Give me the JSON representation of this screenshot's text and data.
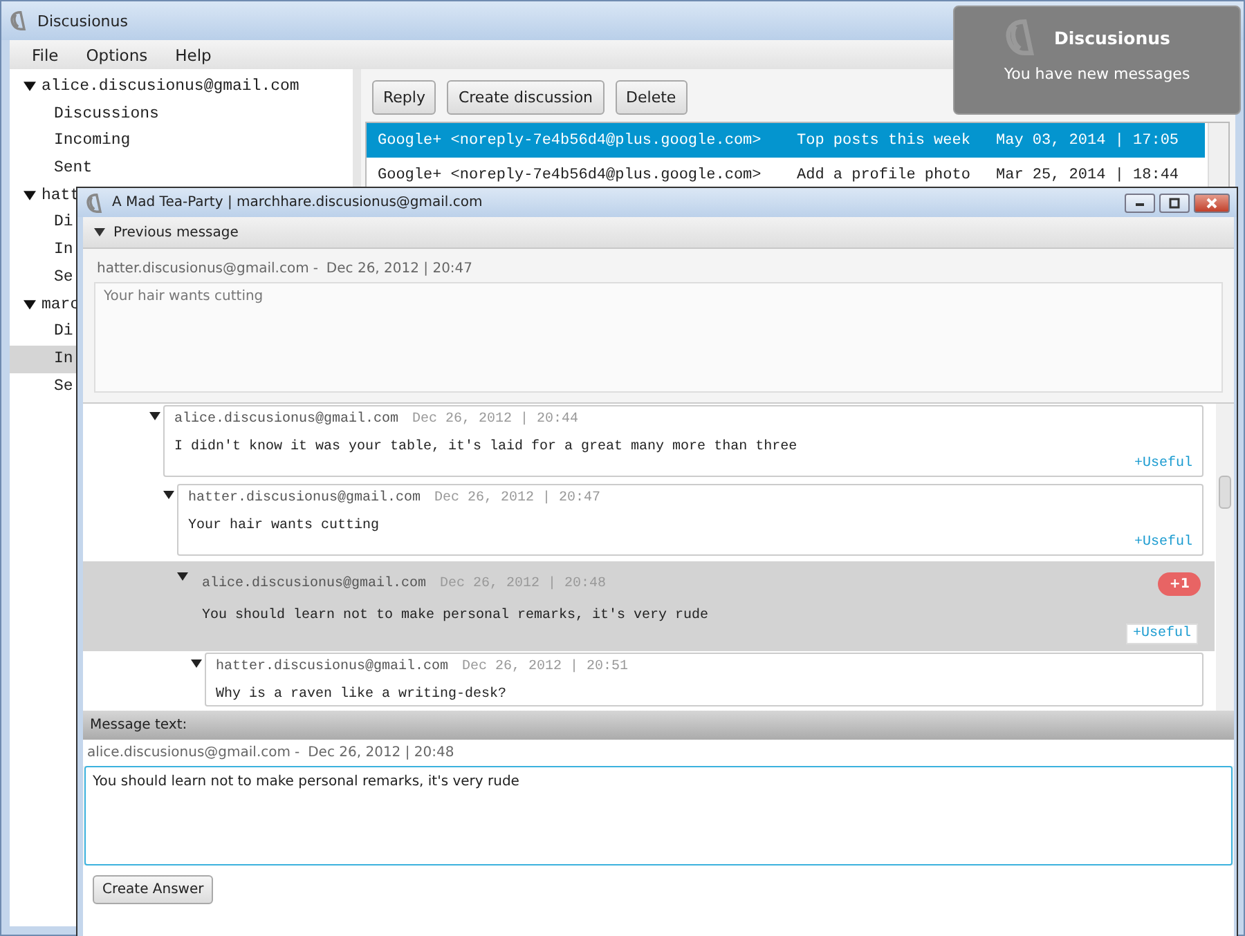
{
  "window": {
    "title": "Discusionus"
  },
  "menu": [
    "File",
    "Options",
    "Help"
  ],
  "accounts": [
    {
      "label": "alice.discusionus@gmail.com",
      "expanded": true,
      "children": [
        {
          "label": "Discussions",
          "selected": false
        },
        {
          "label": "Incoming",
          "selected": false
        },
        {
          "label": "Sent",
          "selected": false
        }
      ]
    },
    {
      "label": "hatt",
      "expanded": true,
      "children": [
        {
          "label": "Di",
          "selected": false
        },
        {
          "label": "In",
          "selected": false
        },
        {
          "label": "Se",
          "selected": false
        }
      ]
    },
    {
      "label": "marc",
      "expanded": true,
      "children": [
        {
          "label": "Di",
          "selected": false
        },
        {
          "label": "In",
          "selected": true
        },
        {
          "label": "Se",
          "selected": false
        }
      ]
    }
  ],
  "toolbar": [
    "Reply",
    "Create discussion",
    "Delete"
  ],
  "messages": [
    {
      "sender": "Google+ <noreply-7e4b56d4@plus.google.com>",
      "subject": "Top posts this week",
      "date": "May 03, 2014 | 17:05",
      "selected": true
    },
    {
      "sender": "Google+ <noreply-7e4b56d4@plus.google.com>",
      "subject": "Add a profile photo",
      "date": "Mar 25, 2014 | 18:44",
      "selected": false
    }
  ],
  "notification": {
    "title": "Discusionus",
    "text": "You have new messages"
  },
  "dialog": {
    "title": "A Mad Tea-Party | marchhare.discusionus@gmail.com",
    "previous": {
      "label": "Previous message",
      "expanded": true,
      "author": "hatter.discusionus@gmail.com",
      "separator": "-",
      "date": "Dec 26, 2012 | 20:47",
      "text": "Your hair wants cutting"
    },
    "thread": [
      {
        "author": "alice.discusionus@gmail.com",
        "date": "Dec 26, 2012 | 20:44",
        "text": "I didn't know it was your table, it's laid for a great many more than three",
        "useful": "+Useful",
        "selected": false,
        "expanded": true,
        "children": [
          {
            "author": "hatter.discusionus@gmail.com",
            "date": "Dec 26, 2012 | 20:47",
            "text": "Your hair wants cutting",
            "useful": "+Useful",
            "selected": false,
            "expanded": true,
            "children": [
              {
                "author": "alice.discusionus@gmail.com",
                "date": "Dec 26, 2012 | 20:48",
                "text": "You should learn not to make personal remarks, it's very rude",
                "useful": "+Useful",
                "votes": "+1",
                "selected": true,
                "expanded": true,
                "children": [
                  {
                    "author": "hatter.discusionus@gmail.com",
                    "date": "Dec 26, 2012 | 20:51",
                    "text": "Why is a raven like a writing-desk?",
                    "selected": false,
                    "expanded": true
                  }
                ]
              }
            ]
          }
        ]
      }
    ],
    "message_label": "Message text:",
    "reply_to": {
      "author": "alice.discusionus@gmail.com",
      "separator": "-",
      "date": "Dec 26, 2012 | 20:48"
    },
    "message_value": "You should learn not to make personal remarks, it's very rude",
    "button": "Create Answer"
  }
}
